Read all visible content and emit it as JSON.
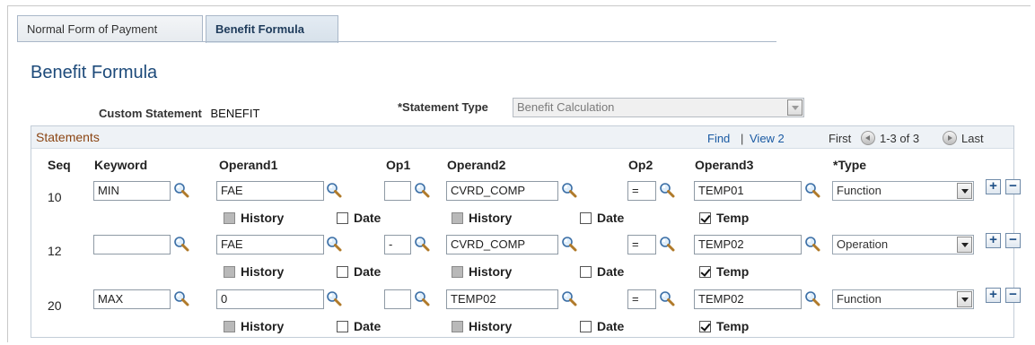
{
  "tabs": [
    {
      "label": "Normal Form of Payment",
      "active": false
    },
    {
      "label": "Benefit Formula",
      "active": true
    }
  ],
  "page_title": "Benefit Formula",
  "custom_statement": {
    "label": "Custom Statement",
    "value": "BENEFIT"
  },
  "statement_type": {
    "label": "*Statement Type",
    "value": "Benefit Calculation",
    "disabled": true
  },
  "grid": {
    "title": "Statements",
    "find_label": "Find",
    "view_label": "View 2",
    "separator": "|",
    "first_label": "First",
    "range_label": "1-3 of 3",
    "last_label": "Last",
    "columns": {
      "seq": "Seq",
      "keyword": "Keyword",
      "operand1": "Operand1",
      "op1": "Op1",
      "operand2": "Operand2",
      "op2": "Op2",
      "operand3": "Operand3",
      "type": "*Type"
    },
    "checkbox_labels": {
      "history": "History",
      "date": "Date",
      "temp": "Temp"
    },
    "add_label": "+",
    "delete_label": "−",
    "rows": [
      {
        "seq": "10",
        "keyword": "MIN",
        "operand1": "FAE",
        "op1": "",
        "operand2": "CVRD_COMP",
        "op2": "=",
        "operand3": "TEMP01",
        "type": "Function",
        "history1": false,
        "date1": false,
        "history2": false,
        "date2": false,
        "temp": true
      },
      {
        "seq": "12",
        "keyword": "",
        "operand1": "FAE",
        "op1": "-",
        "operand2": "CVRD_COMP",
        "op2": "=",
        "operand3": "TEMP02",
        "type": "Operation",
        "history1": false,
        "date1": false,
        "history2": false,
        "date2": false,
        "temp": true
      },
      {
        "seq": "20",
        "keyword": "MAX",
        "operand1": "0",
        "op1": "",
        "operand2": "TEMP02",
        "op2": "=",
        "operand3": "TEMP02",
        "type": "Function",
        "history1": false,
        "date1": false,
        "history2": false,
        "date2": false,
        "temp": true
      }
    ]
  },
  "icons": {
    "lookup": "magnifier-icon",
    "prev": "arrow-left-circle-icon",
    "next": "arrow-right-circle-icon"
  },
  "colors": {
    "accent": "#1d4a7a",
    "link": "#1a5aa3",
    "grid_title": "#8b4513"
  }
}
